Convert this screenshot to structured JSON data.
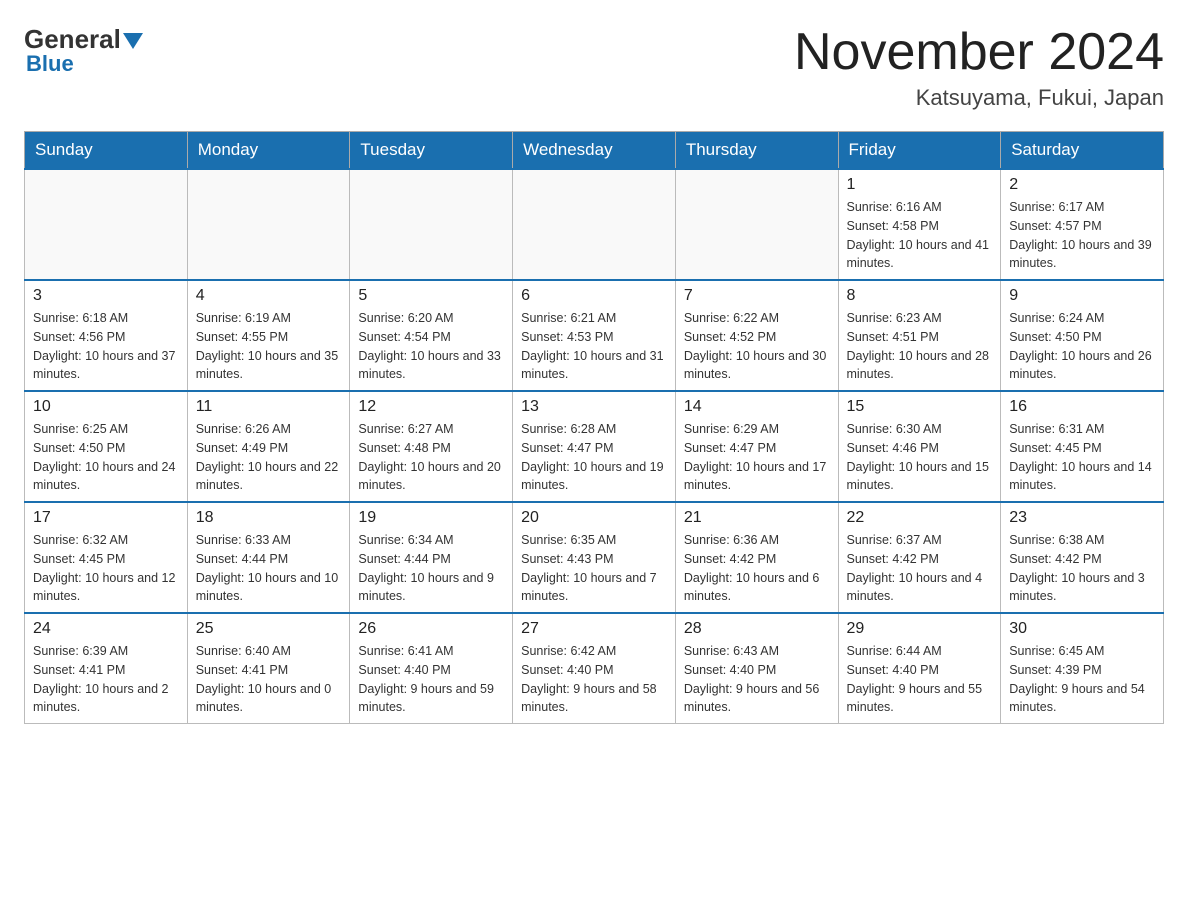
{
  "logo": {
    "general": "General",
    "blue": "Blue"
  },
  "header": {
    "month_title": "November 2024",
    "location": "Katsuyama, Fukui, Japan"
  },
  "weekdays": [
    "Sunday",
    "Monday",
    "Tuesday",
    "Wednesday",
    "Thursday",
    "Friday",
    "Saturday"
  ],
  "weeks": [
    [
      {
        "day": "",
        "info": ""
      },
      {
        "day": "",
        "info": ""
      },
      {
        "day": "",
        "info": ""
      },
      {
        "day": "",
        "info": ""
      },
      {
        "day": "",
        "info": ""
      },
      {
        "day": "1",
        "info": "Sunrise: 6:16 AM\nSunset: 4:58 PM\nDaylight: 10 hours and 41 minutes."
      },
      {
        "day": "2",
        "info": "Sunrise: 6:17 AM\nSunset: 4:57 PM\nDaylight: 10 hours and 39 minutes."
      }
    ],
    [
      {
        "day": "3",
        "info": "Sunrise: 6:18 AM\nSunset: 4:56 PM\nDaylight: 10 hours and 37 minutes."
      },
      {
        "day": "4",
        "info": "Sunrise: 6:19 AM\nSunset: 4:55 PM\nDaylight: 10 hours and 35 minutes."
      },
      {
        "day": "5",
        "info": "Sunrise: 6:20 AM\nSunset: 4:54 PM\nDaylight: 10 hours and 33 minutes."
      },
      {
        "day": "6",
        "info": "Sunrise: 6:21 AM\nSunset: 4:53 PM\nDaylight: 10 hours and 31 minutes."
      },
      {
        "day": "7",
        "info": "Sunrise: 6:22 AM\nSunset: 4:52 PM\nDaylight: 10 hours and 30 minutes."
      },
      {
        "day": "8",
        "info": "Sunrise: 6:23 AM\nSunset: 4:51 PM\nDaylight: 10 hours and 28 minutes."
      },
      {
        "day": "9",
        "info": "Sunrise: 6:24 AM\nSunset: 4:50 PM\nDaylight: 10 hours and 26 minutes."
      }
    ],
    [
      {
        "day": "10",
        "info": "Sunrise: 6:25 AM\nSunset: 4:50 PM\nDaylight: 10 hours and 24 minutes."
      },
      {
        "day": "11",
        "info": "Sunrise: 6:26 AM\nSunset: 4:49 PM\nDaylight: 10 hours and 22 minutes."
      },
      {
        "day": "12",
        "info": "Sunrise: 6:27 AM\nSunset: 4:48 PM\nDaylight: 10 hours and 20 minutes."
      },
      {
        "day": "13",
        "info": "Sunrise: 6:28 AM\nSunset: 4:47 PM\nDaylight: 10 hours and 19 minutes."
      },
      {
        "day": "14",
        "info": "Sunrise: 6:29 AM\nSunset: 4:47 PM\nDaylight: 10 hours and 17 minutes."
      },
      {
        "day": "15",
        "info": "Sunrise: 6:30 AM\nSunset: 4:46 PM\nDaylight: 10 hours and 15 minutes."
      },
      {
        "day": "16",
        "info": "Sunrise: 6:31 AM\nSunset: 4:45 PM\nDaylight: 10 hours and 14 minutes."
      }
    ],
    [
      {
        "day": "17",
        "info": "Sunrise: 6:32 AM\nSunset: 4:45 PM\nDaylight: 10 hours and 12 minutes."
      },
      {
        "day": "18",
        "info": "Sunrise: 6:33 AM\nSunset: 4:44 PM\nDaylight: 10 hours and 10 minutes."
      },
      {
        "day": "19",
        "info": "Sunrise: 6:34 AM\nSunset: 4:44 PM\nDaylight: 10 hours and 9 minutes."
      },
      {
        "day": "20",
        "info": "Sunrise: 6:35 AM\nSunset: 4:43 PM\nDaylight: 10 hours and 7 minutes."
      },
      {
        "day": "21",
        "info": "Sunrise: 6:36 AM\nSunset: 4:42 PM\nDaylight: 10 hours and 6 minutes."
      },
      {
        "day": "22",
        "info": "Sunrise: 6:37 AM\nSunset: 4:42 PM\nDaylight: 10 hours and 4 minutes."
      },
      {
        "day": "23",
        "info": "Sunrise: 6:38 AM\nSunset: 4:42 PM\nDaylight: 10 hours and 3 minutes."
      }
    ],
    [
      {
        "day": "24",
        "info": "Sunrise: 6:39 AM\nSunset: 4:41 PM\nDaylight: 10 hours and 2 minutes."
      },
      {
        "day": "25",
        "info": "Sunrise: 6:40 AM\nSunset: 4:41 PM\nDaylight: 10 hours and 0 minutes."
      },
      {
        "day": "26",
        "info": "Sunrise: 6:41 AM\nSunset: 4:40 PM\nDaylight: 9 hours and 59 minutes."
      },
      {
        "day": "27",
        "info": "Sunrise: 6:42 AM\nSunset: 4:40 PM\nDaylight: 9 hours and 58 minutes."
      },
      {
        "day": "28",
        "info": "Sunrise: 6:43 AM\nSunset: 4:40 PM\nDaylight: 9 hours and 56 minutes."
      },
      {
        "day": "29",
        "info": "Sunrise: 6:44 AM\nSunset: 4:40 PM\nDaylight: 9 hours and 55 minutes."
      },
      {
        "day": "30",
        "info": "Sunrise: 6:45 AM\nSunset: 4:39 PM\nDaylight: 9 hours and 54 minutes."
      }
    ]
  ]
}
